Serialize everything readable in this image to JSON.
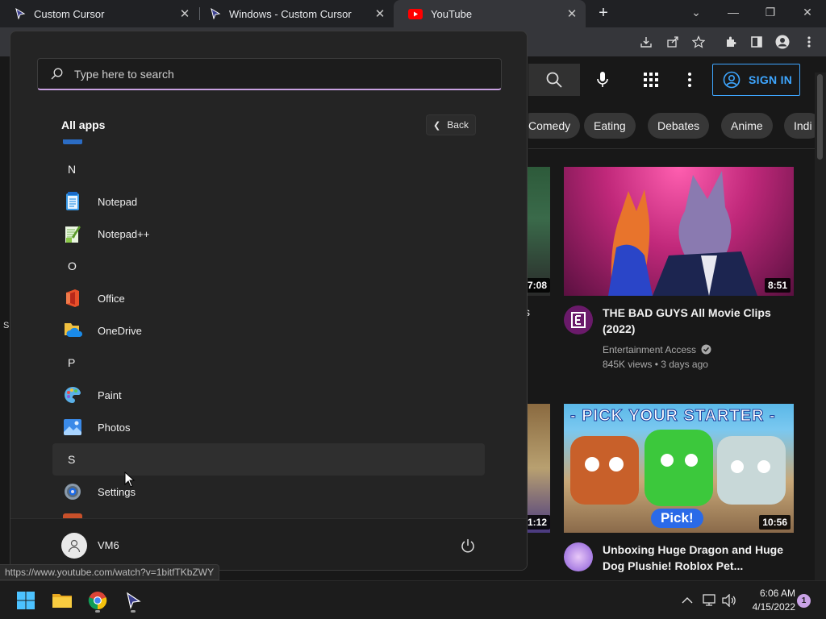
{
  "browser": {
    "tabs": [
      {
        "title": "Custom Cursor",
        "close": "✕"
      },
      {
        "title": "Windows - Custom Cursor",
        "close": "✕"
      },
      {
        "title": "YouTube",
        "close": "✕"
      }
    ],
    "new_tab": "+",
    "window_buttons": {
      "tab_search": "⌄",
      "minimize": "—",
      "restore": "❐",
      "close": "✕"
    },
    "toolbar_icons": [
      "download-icon",
      "share-icon",
      "star-icon",
      "extensions-icon",
      "sidepanel-icon",
      "profile-icon",
      "menu-icon"
    ]
  },
  "youtube": {
    "sign_in": "SIGN IN",
    "chips": [
      "Comedy",
      "Eating",
      "Debates",
      "Anime",
      "Indi"
    ],
    "videos": [
      {
        "title_line1": "THE BAD GUYS All Movie Clips",
        "title_line2": "(2022)",
        "channel": "Entertainment Access",
        "meta": "845K views • 3 days ago",
        "duration": "8:51"
      },
      {
        "title_line1": "Unboxing Huge Dragon and Huge",
        "title_line2": "Dog Plushie! Roblox Pet...",
        "duration": "10:56",
        "banner": "- PICK YOUR STARTER -",
        "pick_label": "Pick!"
      }
    ],
    "partial_durations": [
      "7:08",
      "1:12"
    ],
    "partial_text": "s"
  },
  "start_menu": {
    "search_placeholder": "Type here to search",
    "all_apps_title": "All apps",
    "back_label": "Back",
    "items": [
      {
        "type": "letter",
        "label": "N"
      },
      {
        "type": "app",
        "label": "Notepad",
        "icon": "notepad-icon"
      },
      {
        "type": "app",
        "label": "Notepad++",
        "icon": "notepadpp-icon"
      },
      {
        "type": "letter",
        "label": "O"
      },
      {
        "type": "app",
        "label": "Office",
        "icon": "office-icon"
      },
      {
        "type": "app",
        "label": "OneDrive",
        "icon": "onedrive-icon"
      },
      {
        "type": "letter",
        "label": "P"
      },
      {
        "type": "app",
        "label": "Paint",
        "icon": "paint-icon"
      },
      {
        "type": "app",
        "label": "Photos",
        "icon": "photos-icon"
      },
      {
        "type": "letter",
        "label": "S",
        "hover": true
      },
      {
        "type": "app",
        "label": "Settings",
        "icon": "settings-icon"
      }
    ],
    "user_name": "VM6"
  },
  "status_url": "https://www.youtube.com/watch?v=1bitfTKbZWY",
  "taskbar": {
    "apps": [
      "start-icon",
      "file-explorer-icon",
      "chrome-icon",
      "custom-cursor-icon"
    ],
    "tray": [
      "chevron-up-icon",
      "network-icon",
      "volume-icon"
    ],
    "time": "6:06 AM",
    "date": "4/15/2022",
    "notification_count": "1"
  },
  "left_edge_text": "S",
  "colors": {
    "accent": "#c7a0e0",
    "youtube_blue": "#3ea6ff",
    "start_bg": "#242424"
  }
}
